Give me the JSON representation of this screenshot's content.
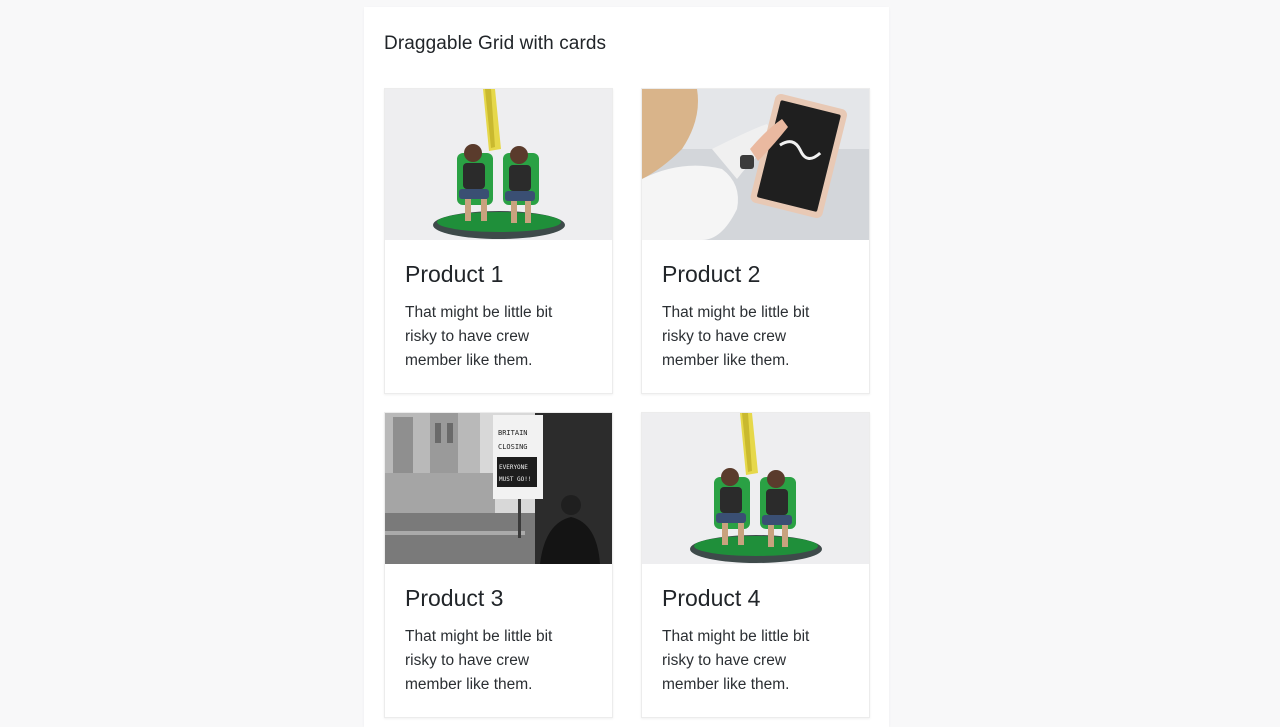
{
  "panel": {
    "title": "Draggable Grid with cards"
  },
  "cards": [
    {
      "title": "Product 1",
      "text": "That might be little bit risky to have crew member like them.",
      "image_icon": "amusement-ride-photo"
    },
    {
      "title": "Product 2",
      "text": "That might be little bit risky to have crew member like them.",
      "image_icon": "tablet-hand-photo"
    },
    {
      "title": "Product 3",
      "text": "That might be little bit risky to have crew member like them.",
      "image_icon": "protest-sign-photo",
      "image_text": [
        "BRITAIN",
        "CLOSING",
        "EVERYONE",
        "MUST GO!!"
      ]
    },
    {
      "title": "Product 4",
      "text": "That might be little bit risky to have crew member like them.",
      "image_icon": "amusement-ride-photo"
    }
  ],
  "colors": {
    "page_background": "#f8f8f9",
    "panel_background": "#ffffff",
    "text": "#212529",
    "card_border": "#ececec"
  }
}
